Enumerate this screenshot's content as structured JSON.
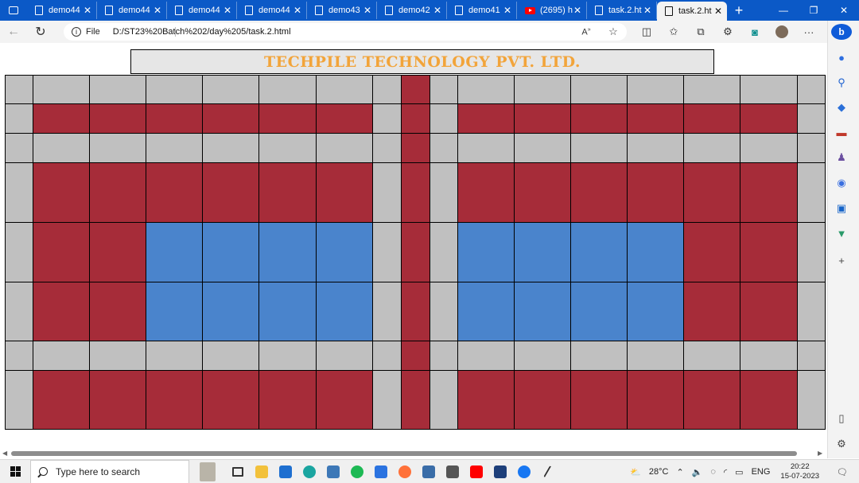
{
  "browser": {
    "tabs": [
      {
        "label": "demo44",
        "icon": "page-icon",
        "active": false
      },
      {
        "label": "demo44",
        "icon": "page-icon",
        "active": false
      },
      {
        "label": "demo44",
        "icon": "page-icon",
        "active": false
      },
      {
        "label": "demo44",
        "icon": "page-icon",
        "active": false
      },
      {
        "label": "demo43",
        "icon": "page-icon",
        "active": false
      },
      {
        "label": "demo42",
        "icon": "page-icon",
        "active": false
      },
      {
        "label": "demo41",
        "icon": "page-icon",
        "active": false
      },
      {
        "label": "(2695) h",
        "icon": "youtube-icon",
        "active": false
      },
      {
        "label": "task.2.ht",
        "icon": "page-icon",
        "active": false
      },
      {
        "label": "task.2.ht",
        "icon": "page-icon",
        "active": true
      }
    ],
    "address": {
      "file_label": "File",
      "url": "D:/ST23%20Batch%202/day%205/task.2.html"
    }
  },
  "page": {
    "heading": "TECHPILE TECHNOLOGY PVT. LTD.",
    "colors": {
      "gray": "#c0c0c0",
      "red": "#a62c39",
      "blue": "#4a84cc",
      "heading": "#f2a43a"
    },
    "grid": {
      "rows": [
        "GGGGGGGGRGGGGGGGG",
        "GRRRRRRGRGRRRRRRG",
        "GGGGGGGGRGGGGGGGG",
        "GRRRRRRGRGRRRRRRG",
        "GRRBBBBGRGBBBBRRG",
        "GRRBBBBGRGBBBBRRG",
        "GGGGGGGGRGGGGGGGG",
        "GRRRRRRGRGRRRRRRG"
      ]
    }
  },
  "taskbar": {
    "search_placeholder": "Type here to search",
    "weather": "28°C",
    "language": "ENG",
    "time": "20:22",
    "date": "15-07-2023"
  }
}
